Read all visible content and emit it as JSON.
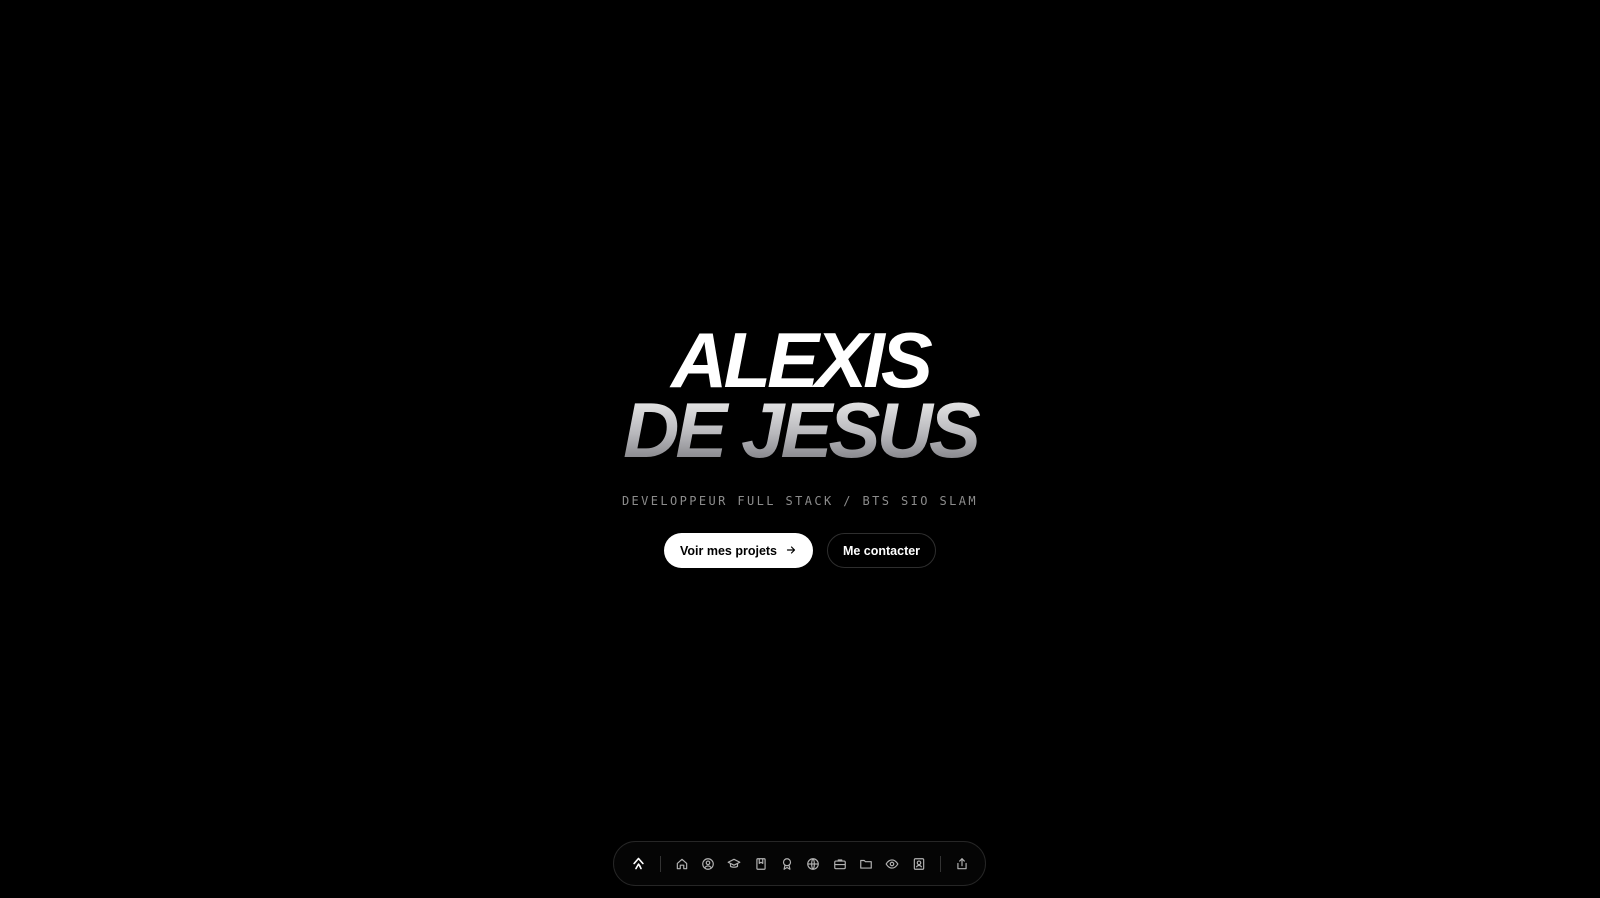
{
  "hero": {
    "name_line_1": "ALEXIS",
    "name_line_2": "DE JESUS",
    "subtitle": "DEVELOPPEUR FULL STACK / BTS SIO SLAM"
  },
  "actions": {
    "primary_label": "Voir mes projets",
    "secondary_label": "Me contacter"
  },
  "dock": {
    "logo_icon": "logo-icon",
    "items": [
      {
        "icon": "home-icon"
      },
      {
        "icon": "user-circle-icon"
      },
      {
        "icon": "graduation-cap-icon"
      },
      {
        "icon": "bookmark-icon"
      },
      {
        "icon": "award-icon"
      },
      {
        "icon": "globe-icon"
      },
      {
        "icon": "briefcase-icon"
      },
      {
        "icon": "folder-icon"
      },
      {
        "icon": "eye-icon"
      },
      {
        "icon": "contact-card-icon"
      }
    ],
    "share_icon": "share-icon"
  },
  "colors": {
    "background": "#000000",
    "primary_button_bg": "#ffffff",
    "subtitle": "#8c8c8c",
    "dock_icon": "#b3b3b3"
  }
}
